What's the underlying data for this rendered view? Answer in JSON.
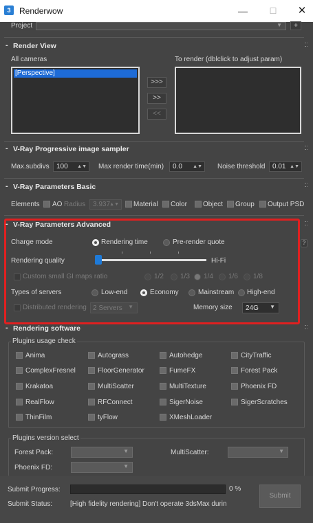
{
  "window": {
    "title": "Renderwow",
    "min": "—",
    "max": "☐",
    "close": "✕"
  },
  "project": {
    "label": "Project",
    "plus": "+"
  },
  "render_view": {
    "title": "Render View",
    "all_cameras_label": "All cameras",
    "to_render_label": "To render (dblclick to adjust param)",
    "cameras": [
      "[Perspective]"
    ],
    "btn_add_all": ">>>",
    "btn_add": ">>",
    "btn_remove": "<<"
  },
  "sampler": {
    "title": "V-Ray Progressive image sampler",
    "max_subdivs_label": "Max.subdivs",
    "max_subdivs_value": "100",
    "max_render_time_label": "Max render time(min)",
    "max_render_time_value": "0.0",
    "noise_threshold_label": "Noise threshold",
    "noise_threshold_value": "0.01"
  },
  "params_basic": {
    "title": "V-Ray Parameters Basic",
    "elements_label": "Elements",
    "ao_label": "AO",
    "radius_label": "Radius",
    "radius_value": "3.937",
    "checks": [
      "Material",
      "Color",
      "Object",
      "Group",
      "Output PSD"
    ]
  },
  "params_advanced": {
    "title": "V-Ray Parameters Advanced",
    "charge_mode_label": "Charge mode",
    "charge_options": [
      "Rendering time",
      "Pre-render quote"
    ],
    "charge_selected": "Rendering time",
    "quality_label": "Rendering quality",
    "quality_value_label": "Hi-Fi",
    "quality_level": 0.0,
    "gi_ratio_label": "Custom small GI maps ratio",
    "gi_options": [
      "1/2",
      "1/3",
      "1/4",
      "1/6",
      "1/8"
    ],
    "gi_selected": "1/4",
    "servers_label": "Types of servers",
    "server_options": [
      "Low-end",
      "Economy",
      "Mainstream",
      "High-end"
    ],
    "server_selected": "Economy",
    "distributed_label": "Distributed rendering",
    "distributed_value": "2 Servers",
    "memory_label": "Memory size",
    "memory_value": "24G",
    "help": "?"
  },
  "software": {
    "title": "Rendering software",
    "plugins_check_label": "Plugins usage check",
    "plugins": [
      "Anima",
      "Autograss",
      "Autohedge",
      "CityTraffic",
      "ComplexFresnel",
      "FloorGenerator",
      "FumeFX",
      "Forest Pack",
      "Krakatoa",
      "MultiScatter",
      "MultiTexture",
      "Phoenix FD",
      "RealFlow",
      "RFConnect",
      "SigerNoise",
      "SigerScratches",
      "ThinFilm",
      "tyFlow",
      "XMeshLoader"
    ],
    "version_select_label": "Plugins version select",
    "forest_pack_label": "Forest Pack:",
    "multiscatter_label": "MultiScatter:",
    "phoenix_label": "Phoenix FD:"
  },
  "footer": {
    "submit_progress_label": "Submit Progress:",
    "progress_percent": "0 %",
    "progress_value": 0,
    "submit_status_label": "Submit Status:",
    "submit_status_text": "[High fidelity rendering] Don't operate 3dsMax durin",
    "submit_button": "Submit"
  }
}
